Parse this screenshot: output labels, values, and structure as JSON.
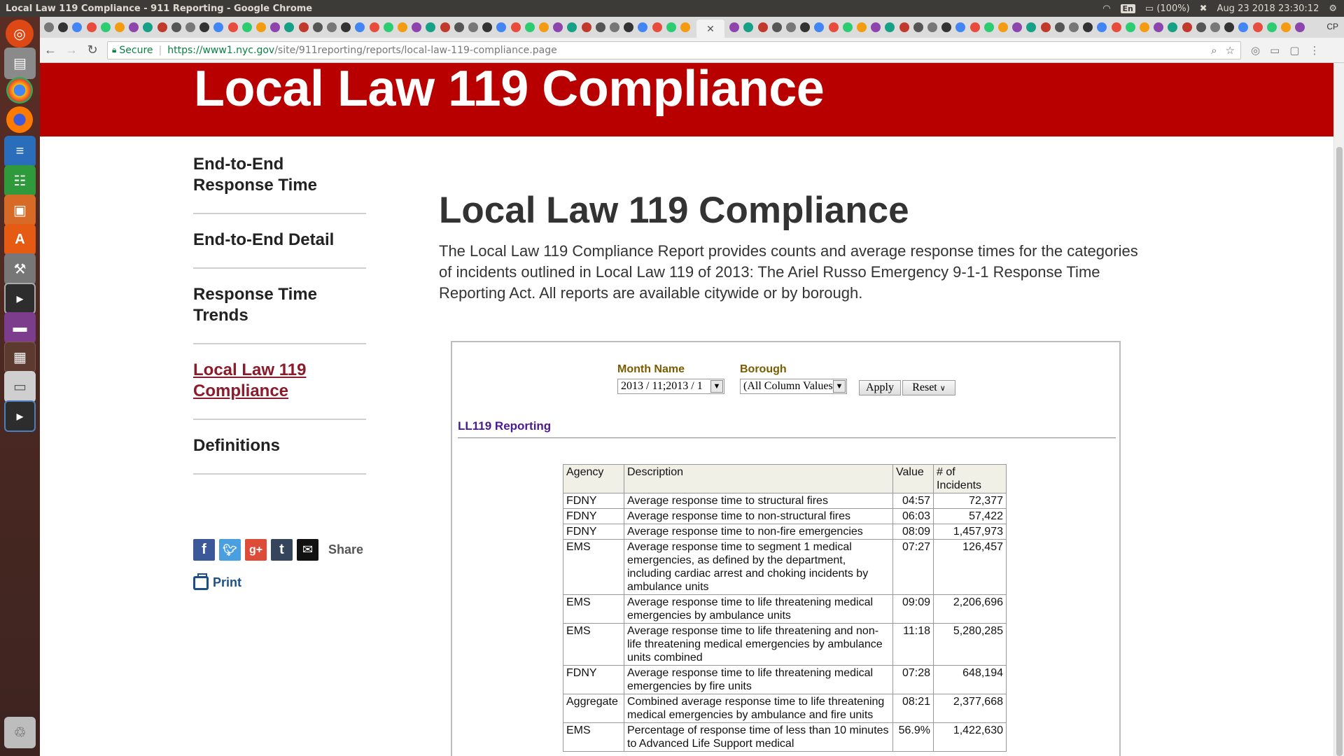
{
  "os": {
    "window_title": "Local Law 119 Compliance - 911 Reporting - Google Chrome",
    "keyboard": "En",
    "battery": "(100%)",
    "datetime": "Aug 23 2018 23:30:12"
  },
  "browser": {
    "profile": "CP",
    "secure_label": "Secure",
    "url_scheme": "https://",
    "url_host": "www1.nyc.gov",
    "url_path": "/site/911reporting/reports/local-law-119-compliance.page"
  },
  "page": {
    "banner_title": "Local Law 119 Compliance",
    "nav": [
      {
        "label": "End-to-End Response Time"
      },
      {
        "label": "End-to-End Detail"
      },
      {
        "label": "Response Time Trends"
      },
      {
        "label": "Local Law 119 Compliance",
        "active": true
      },
      {
        "label": "Definitions"
      }
    ],
    "share_label": "Share",
    "print_label": "Print",
    "main_title": "Local Law 119 Compliance",
    "intro": "The Local Law 119 Compliance Report provides counts and average response times for the categories of incidents outlined in Local Law 119 of 2013: The Ariel Russo Emergency 9-1-1 Response Time Reporting Act. All reports are available citywide or by borough."
  },
  "report": {
    "month_label": "Month Name",
    "month_value": "2013 / 11;2013 / 1",
    "borough_label": "Borough",
    "borough_value": "(All Column Values)",
    "apply_label": "Apply",
    "reset_label": "Reset",
    "section_title": "LL119 Reporting",
    "columns": [
      "Agency",
      "Description",
      "Value",
      "# of Incidents"
    ],
    "rows": [
      {
        "agency": "FDNY",
        "description": "Average response time to structural fires",
        "value": "04:57",
        "incidents": "72,377"
      },
      {
        "agency": "FDNY",
        "description": "Average response time to non-structural fires",
        "value": "06:03",
        "incidents": "57,422"
      },
      {
        "agency": "FDNY",
        "description": "Average response time to non-fire emergencies",
        "value": "08:09",
        "incidents": "1,457,973"
      },
      {
        "agency": "EMS",
        "description": "Average response time to segment 1 medical emergencies, as defined by the department, including cardiac arrest and choking incidents by ambulance units",
        "value": "07:27",
        "incidents": "126,457"
      },
      {
        "agency": "EMS",
        "description": "Average response time to life threatening medical emergencies by ambulance units",
        "value": "09:09",
        "incidents": "2,206,696"
      },
      {
        "agency": "EMS",
        "description": "Average response time to life threatening and non-life threatening medical emergencies by ambulance units combined",
        "value": "11:18",
        "incidents": "5,280,285"
      },
      {
        "agency": "FDNY",
        "description": "Average response time to life threatening medical emergencies by fire units",
        "value": "07:28",
        "incidents": "648,194"
      },
      {
        "agency": "Aggregate",
        "description": "Combined average response time to life threatening medical emergencies by ambulance and fire units",
        "value": "08:21",
        "incidents": "2,377,668"
      },
      {
        "agency": "EMS",
        "description": "Percentage of response time of less than 10 minutes to Advanced Life Support medical",
        "value": "56.9%",
        "incidents": "1,422,630"
      }
    ]
  },
  "colors": {
    "banner": "#b80000",
    "nav_active": "#8b1a2b",
    "report_title": "#4a1a8f",
    "prompt_label": "#7b5b00"
  }
}
